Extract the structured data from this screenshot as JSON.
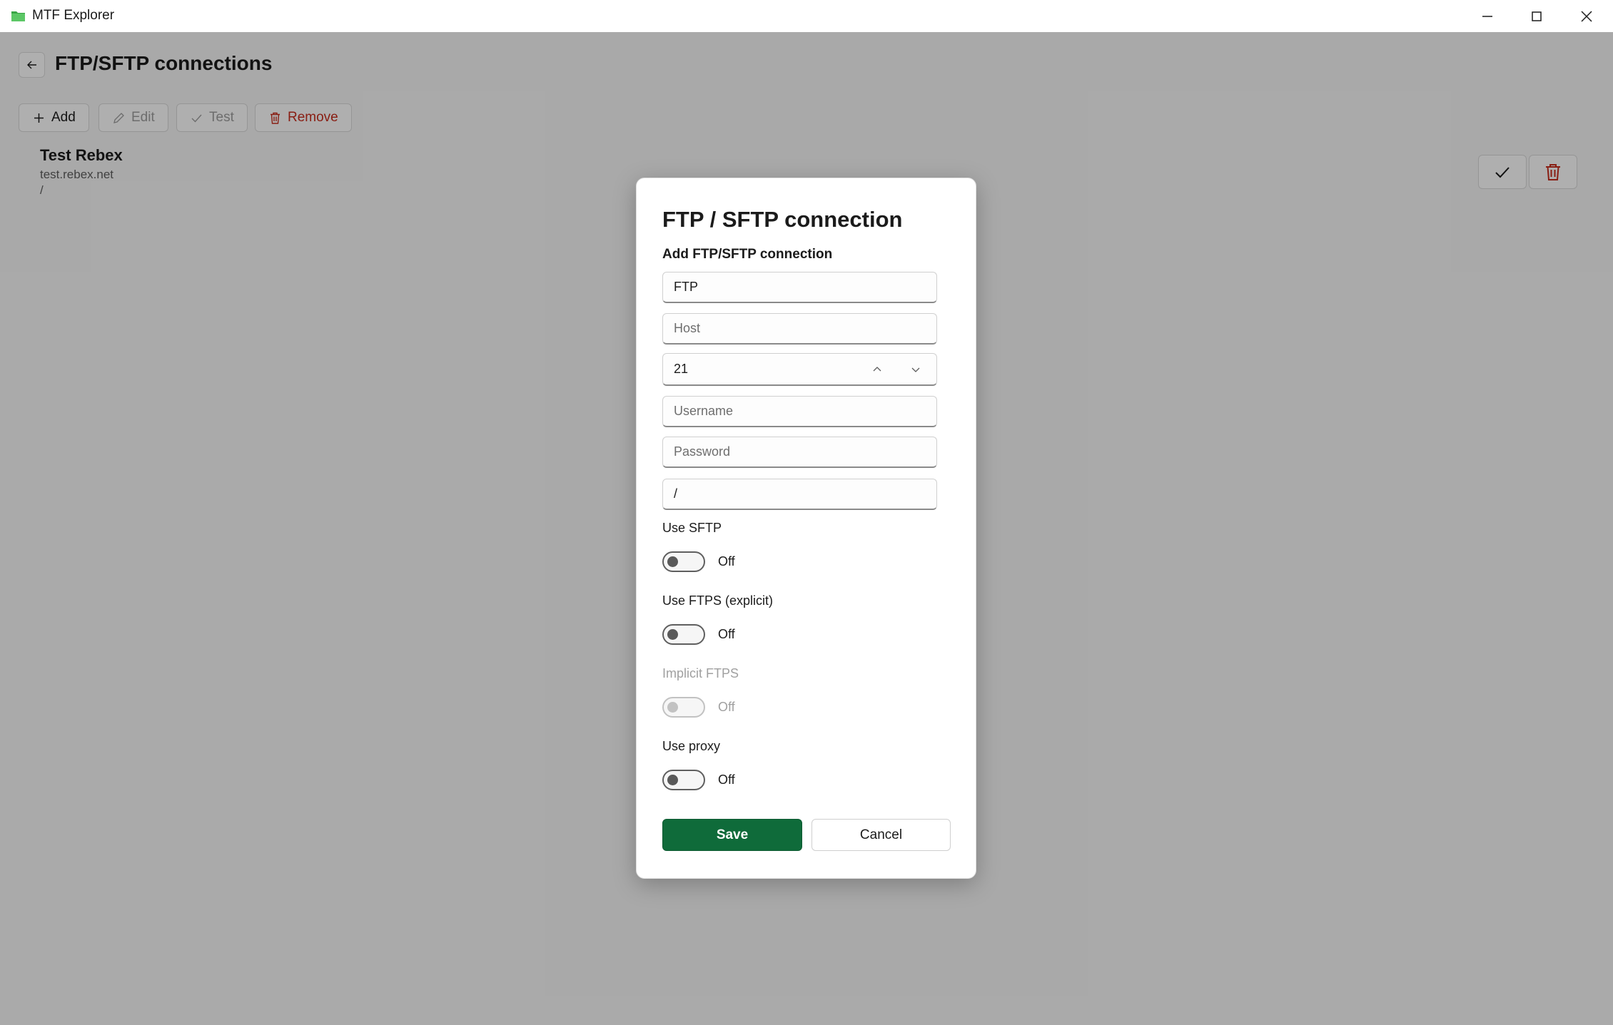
{
  "window": {
    "title": "MTF Explorer",
    "icon": "folder-icon",
    "controls": [
      "minimize-icon",
      "maximize-icon",
      "close-icon"
    ]
  },
  "page": {
    "title": "FTP/SFTP connections",
    "back_icon": "back-arrow-icon"
  },
  "toolbar": {
    "add_label": "Add",
    "edit_label": "Edit",
    "test_label": "Test",
    "remove_label": "Remove"
  },
  "connections": [
    {
      "name": "Test Rebex",
      "host": "test.rebex.net",
      "path": "/"
    }
  ],
  "dialog": {
    "title": "FTP / SFTP connection",
    "subtitle": "Add FTP/SFTP connection",
    "fields": {
      "name": {
        "value": "FTP",
        "placeholder": ""
      },
      "host": {
        "value": "",
        "placeholder": "Host"
      },
      "port": {
        "value": "21"
      },
      "username": {
        "value": "",
        "placeholder": "Username"
      },
      "password": {
        "value": "",
        "placeholder": "Password"
      },
      "path": {
        "value": "/",
        "placeholder": ""
      }
    },
    "toggles": {
      "sftp": {
        "label": "Use SFTP",
        "state": "Off"
      },
      "ftps_explicit": {
        "label": "Use FTPS (explicit)",
        "state": "Off"
      },
      "ftps_implicit": {
        "label": "Implicit FTPS",
        "state": "Off"
      },
      "proxy": {
        "label": "Use proxy",
        "state": "Off"
      }
    },
    "save_label": "Save",
    "cancel_label": "Cancel"
  },
  "colors": {
    "accent": "#0f6b3a",
    "danger": "#c42b1c",
    "overlay": "rgba(0,0,0,0.30)"
  }
}
